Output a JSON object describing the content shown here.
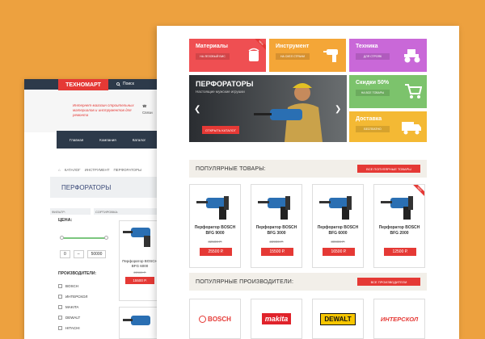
{
  "back": {
    "logo": "ТЕХНОМАРТ",
    "search": "Поиск",
    "promo": "Интернет-магазин строительных материалов и инструментов для ремонта",
    "contact": "Связи",
    "nav": [
      "Главная",
      "Компания",
      "Каталог"
    ],
    "crumbs": [
      "КАТАЛОГ",
      "ИНСТРУМЕНТ",
      "ПЕРФОРАТОРЫ"
    ],
    "title": "ПЕРФОРАТОРЫ",
    "filter_label": "ФИЛЬТР:",
    "sort_label": "СОРТИРОВКА:",
    "price_label": "ЦЕНА:",
    "price_from": "0",
    "price_to": "50000",
    "mfr_label": "ПРОИЗВОДИТЕЛИ:",
    "mfr_list": [
      "BOSCH",
      "ИНТЕРСКОЛ",
      "MAKITA",
      "DEWALT",
      "HITACHI"
    ],
    "card": {
      "name": "Перфоратор BOSCH BFG 6000",
      "old": "22900 Р.",
      "price": "15500 Р."
    }
  },
  "front": {
    "tiles": [
      {
        "title": "Материалы",
        "btn": "НА ЛЕЗОВЫЙ ВИС",
        "color": "#ef4f52",
        "ribbon": "NEW"
      },
      {
        "title": "Инструмент",
        "btn": "НА СКЕЛ СТРАНИ",
        "color": "#f4a637"
      },
      {
        "title": "Техника",
        "btn": "ДЛЯ СТРОЯК",
        "color": "#c968d8"
      },
      {
        "title": "Скидки 50%",
        "btn": "НА ВСЕ ТОВАРЫ",
        "color": "#7cc36c"
      },
      {
        "title": "Доставка",
        "btn": "БЕСПЛАТНО",
        "color": "#f4b934"
      }
    ],
    "hero": {
      "title": "ПЕРФОРАТОРЫ",
      "subtitle": "Настоящие мужские игрушки",
      "button": "ОТКРЫТЬ КАТАЛОГ",
      "prev": "❮",
      "next": "❯"
    },
    "popular": {
      "title": "ПОПУЛЯРНЫЕ ТОВАРЫ:",
      "button": "ВСЕ ПОПУЛЯРНЫЕ ТОВАРЫ"
    },
    "products": [
      {
        "name": "Перфоратор BOSCH BFG 9000",
        "old": "32500 Р.",
        "price": "25500 Р."
      },
      {
        "name": "Перфоратор BOSCH BFG 3000",
        "old": "22900 Р.",
        "price": "15500 Р."
      },
      {
        "name": "Перфоратор BOSCH BFG 6000",
        "old": "30900 Р.",
        "price": "16500 Р."
      },
      {
        "name": "Перфоратор BOSCH BFG 2000",
        "old": "",
        "price": "12500 Р.",
        "ribbon": "NEW"
      }
    ],
    "brands_section": {
      "title": "ПОПУЛЯРНЫЕ ПРОИЗВОДИТЕЛИ:",
      "button": "ВСЕ ПРОИЗВОДИТЕЛИ"
    },
    "brands": [
      "BOSCH",
      "makita",
      "DEWALT",
      "ИНТЕРСКОЛ"
    ]
  }
}
